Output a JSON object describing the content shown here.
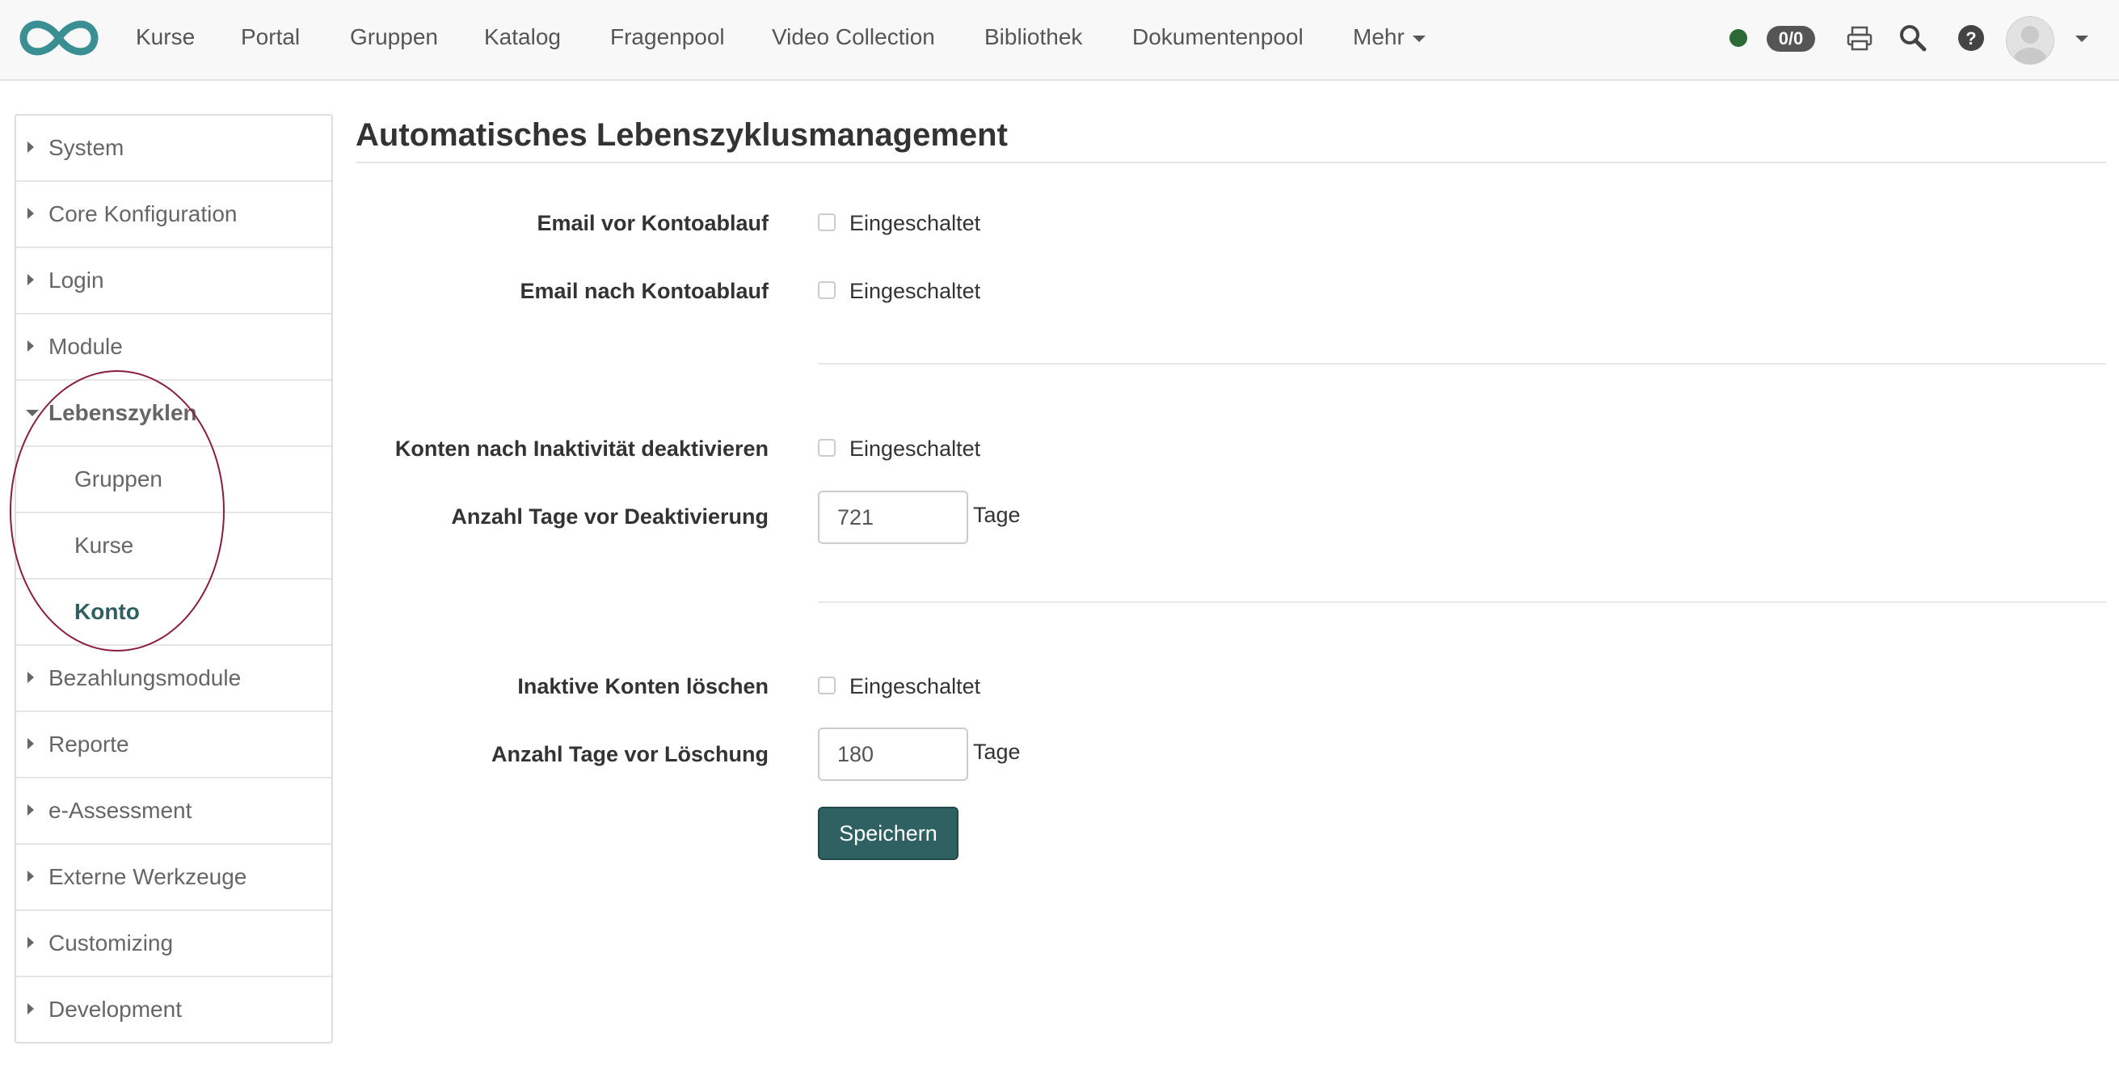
{
  "header": {
    "nav": [
      {
        "label": "Kurse"
      },
      {
        "label": "Portal"
      },
      {
        "label": "Gruppen"
      },
      {
        "label": "Katalog"
      },
      {
        "label": "Fragenpool"
      },
      {
        "label": "Video Collection"
      },
      {
        "label": "Bibliothek"
      },
      {
        "label": "Dokumentenpool"
      },
      {
        "label": "Mehr"
      }
    ],
    "badge": "0/0",
    "icons": [
      "logo-icon",
      "print-icon",
      "search-icon",
      "help-icon",
      "avatar",
      "chevron-down-icon"
    ],
    "status_color": "#2b6a34"
  },
  "sidebar": {
    "items": [
      {
        "label": "System",
        "expanded": false
      },
      {
        "label": "Core Konfiguration",
        "expanded": false
      },
      {
        "label": "Login",
        "expanded": false
      },
      {
        "label": "Module",
        "expanded": false
      },
      {
        "label": "Lebenszyklen",
        "expanded": true
      },
      {
        "label": "Gruppen",
        "sub": true
      },
      {
        "label": "Kurse",
        "sub": true
      },
      {
        "label": "Konto",
        "sub": true,
        "active": true
      },
      {
        "label": "Bezahlungsmodule",
        "expanded": false
      },
      {
        "label": "Reporte",
        "expanded": false
      },
      {
        "label": "e-Assessment",
        "expanded": false
      },
      {
        "label": "Externe Werkzeuge",
        "expanded": false
      },
      {
        "label": "Customizing",
        "expanded": false
      },
      {
        "label": "Development",
        "expanded": false
      }
    ],
    "annotation_color": "#8a1c42"
  },
  "main": {
    "title": "Automatisches Lebenszyklusmanagement",
    "fields": {
      "email_before": {
        "label": "Email vor Kontoablauf",
        "checkbox_label": "Eingeschaltet",
        "checked": false
      },
      "email_after": {
        "label": "Email nach Kontoablauf",
        "checkbox_label": "Eingeschaltet",
        "checked": false
      },
      "deactivate": {
        "label": "Konten nach Inaktivität deaktivieren",
        "checkbox_label": "Eingeschaltet",
        "checked": false
      },
      "days_deactivate": {
        "label": "Anzahl Tage vor Deaktivierung",
        "value": "721",
        "unit": "Tage"
      },
      "delete_inactive": {
        "label": "Inaktive Konten löschen",
        "checkbox_label": "Eingeschaltet",
        "checked": false
      },
      "days_delete": {
        "label": "Anzahl Tage vor Löschung",
        "value": "180",
        "unit": "Tage"
      }
    },
    "save_label": "Speichern",
    "accent_color": "#2f6163"
  }
}
